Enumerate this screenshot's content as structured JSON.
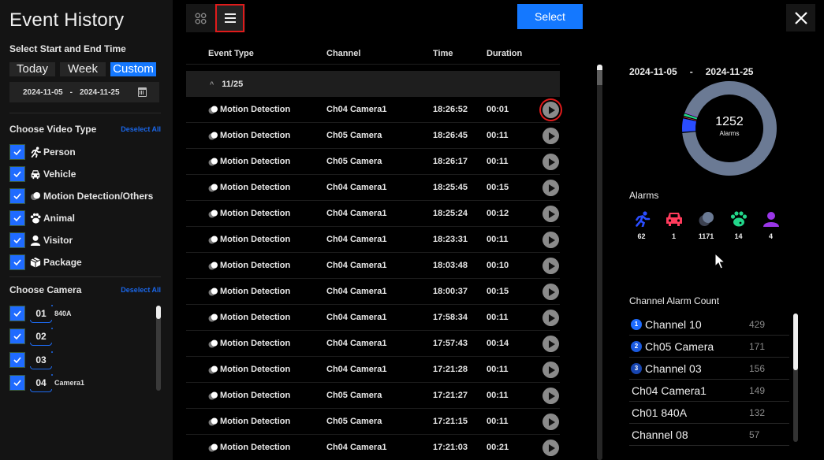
{
  "sidebar": {
    "title": "Event History",
    "time_section_label": "Select Start and End Time",
    "range_tabs": [
      {
        "label": "Today",
        "active": false
      },
      {
        "label": "Week",
        "active": false
      },
      {
        "label": "Custom",
        "active": true
      }
    ],
    "date_range": {
      "start": "2024-11-05",
      "separator": "-",
      "end": "2024-11-25",
      "icon": "calendar-icon"
    },
    "video_type": {
      "label": "Choose Video Type",
      "deselect_label": "Deselect All",
      "items": [
        {
          "label": "Person",
          "icon": "person-running-icon",
          "checked": true
        },
        {
          "label": "Vehicle",
          "icon": "vehicle-icon",
          "checked": true
        },
        {
          "label": "Motion Detection/Others",
          "icon": "motion-icon",
          "checked": true
        },
        {
          "label": "Animal",
          "icon": "paw-icon",
          "checked": true
        },
        {
          "label": "Visitor",
          "icon": "visitor-icon",
          "checked": true
        },
        {
          "label": "Package",
          "icon": "package-icon",
          "checked": true
        }
      ]
    },
    "camera": {
      "label": "Choose Camera",
      "deselect_label": "Deselect All",
      "items": [
        {
          "number": "01",
          "name": "840A",
          "checked": true
        },
        {
          "number": "02",
          "name": "",
          "checked": true
        },
        {
          "number": "03",
          "name": "",
          "checked": true
        },
        {
          "number": "04",
          "name": "Camera1",
          "checked": true
        }
      ]
    }
  },
  "toolbar": {
    "grid_view_icon": "grid-icon",
    "list_view_icon": "list-icon",
    "active_view": "list",
    "select_label": "Select",
    "close_icon": "close-icon"
  },
  "events": {
    "columns": {
      "type": "Event Type",
      "channel": "Channel",
      "time": "Time",
      "duration": "Duration"
    },
    "group": {
      "label": "11/25",
      "expanded": true
    },
    "rows": [
      {
        "type": "Motion Detection",
        "channel": "Ch04 Camera1",
        "time": "18:26:52",
        "duration": "00:01"
      },
      {
        "type": "Motion Detection",
        "channel": "Ch05 Camera",
        "time": "18:26:45",
        "duration": "00:11"
      },
      {
        "type": "Motion Detection",
        "channel": "Ch05 Camera",
        "time": "18:26:17",
        "duration": "00:11"
      },
      {
        "type": "Motion Detection",
        "channel": "Ch04 Camera1",
        "time": "18:25:45",
        "duration": "00:15"
      },
      {
        "type": "Motion Detection",
        "channel": "Ch04 Camera1",
        "time": "18:25:24",
        "duration": "00:12"
      },
      {
        "type": "Motion Detection",
        "channel": "Ch04 Camera1",
        "time": "18:23:31",
        "duration": "00:11"
      },
      {
        "type": "Motion Detection",
        "channel": "Ch04 Camera1",
        "time": "18:03:48",
        "duration": "00:10"
      },
      {
        "type": "Motion Detection",
        "channel": "Ch04 Camera1",
        "time": "18:00:37",
        "duration": "00:15"
      },
      {
        "type": "Motion Detection",
        "channel": "Ch04 Camera1",
        "time": "17:58:34",
        "duration": "00:11"
      },
      {
        "type": "Motion Detection",
        "channel": "Ch04 Camera1",
        "time": "17:57:43",
        "duration": "00:14"
      },
      {
        "type": "Motion Detection",
        "channel": "Ch04 Camera1",
        "time": "17:21:28",
        "duration": "00:11"
      },
      {
        "type": "Motion Detection",
        "channel": "Ch05 Camera",
        "time": "17:21:27",
        "duration": "00:11"
      },
      {
        "type": "Motion Detection",
        "channel": "Ch05 Camera",
        "time": "17:21:15",
        "duration": "00:11"
      },
      {
        "type": "Motion Detection",
        "channel": "Ch04 Camera1",
        "time": "17:21:03",
        "duration": "00:21"
      }
    ]
  },
  "stats": {
    "date_start": "2024-11-05",
    "date_separator": "-",
    "date_end": "2024-11-25",
    "total": "1252",
    "total_label": "Alarms",
    "alarms_label": "Alarms",
    "alarm_types": [
      {
        "name": "Person",
        "icon": "person-running-icon",
        "count": 62,
        "color": "#2a4dff"
      },
      {
        "name": "Vehicle",
        "icon": "vehicle-icon",
        "count": 1,
        "color": "#ff3b5c"
      },
      {
        "name": "Motion Detection/Others",
        "icon": "motion-icon",
        "count": 1171,
        "color": "#6b7a94"
      },
      {
        "name": "Animal",
        "icon": "paw-icon",
        "count": 14,
        "color": "#22d68a"
      },
      {
        "name": "Visitor",
        "icon": "visitor-icon",
        "count": 4,
        "color": "#9a36e8"
      }
    ],
    "channel_count_label": "Channel Alarm Count",
    "channels": [
      {
        "rank": "1",
        "name": "Channel 10",
        "count": "429",
        "rank_color": "#1e6cff"
      },
      {
        "rank": "2",
        "name": "Ch05 Camera",
        "count": "171",
        "rank_color": "#1a5ae0"
      },
      {
        "rank": "3",
        "name": "Channel 03",
        "count": "156",
        "rank_color": "#1745b0"
      },
      {
        "rank": "",
        "name": "Ch04 Camera1",
        "count": "149"
      },
      {
        "rank": "",
        "name": "Ch01 840A",
        "count": "132"
      },
      {
        "rank": "",
        "name": "Channel 08",
        "count": "57"
      }
    ]
  },
  "colors": {
    "accent": "#1478ff",
    "focus_outline": "#e01b1b",
    "sidebar_bg": "#141414"
  }
}
